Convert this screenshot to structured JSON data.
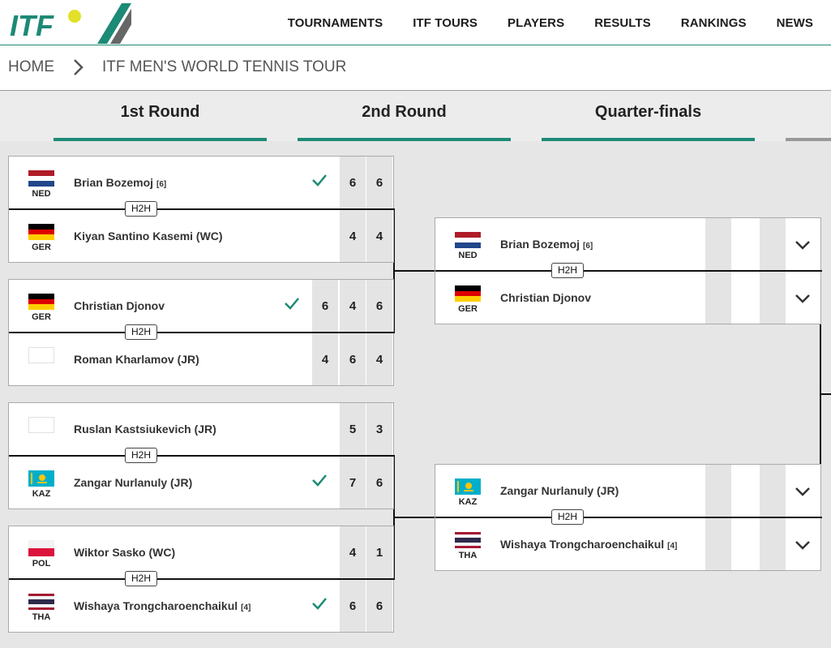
{
  "header": {
    "logo_text": "ITF",
    "nav": [
      "TOURNAMENTS",
      "ITF TOURS",
      "PLAYERS",
      "RESULTS",
      "RANKINGS",
      "NEWS"
    ],
    "brand_color": "#1d8a76"
  },
  "breadcrumb": {
    "home": "HOME",
    "separator": ">",
    "current": "ITF MEN'S WORLD TENNIS TOUR"
  },
  "rounds": [
    "1st Round",
    "2nd Round",
    "Quarter-finals"
  ],
  "h2h_label": "H2H",
  "first_round": [
    {
      "players": [
        {
          "name": "Brian Bozemoj",
          "seed": "[6]",
          "country": "NED",
          "flag": "ned",
          "winner": true,
          "scores": [
            "6",
            "6"
          ]
        },
        {
          "name": "Kiyan Santino Kasemi (WC)",
          "seed": "",
          "country": "GER",
          "flag": "ger",
          "winner": false,
          "scores": [
            "4",
            "4"
          ]
        }
      ]
    },
    {
      "players": [
        {
          "name": "Christian Djonov",
          "seed": "",
          "country": "GER",
          "flag": "ger",
          "winner": true,
          "scores": [
            "6",
            "4",
            "6"
          ]
        },
        {
          "name": "Roman Kharlamov (JR)",
          "seed": "",
          "country": "",
          "flag": "blank",
          "winner": false,
          "scores": [
            "4",
            "6",
            "4"
          ]
        }
      ]
    },
    {
      "players": [
        {
          "name": "Ruslan Kastsiukevich (JR)",
          "seed": "",
          "country": "",
          "flag": "blank",
          "winner": false,
          "scores": [
            "5",
            "3"
          ]
        },
        {
          "name": "Zangar Nurlanuly (JR)",
          "seed": "",
          "country": "KAZ",
          "flag": "kaz",
          "winner": true,
          "scores": [
            "7",
            "6"
          ]
        }
      ]
    },
    {
      "players": [
        {
          "name": "Wiktor Sasko (WC)",
          "seed": "",
          "country": "POL",
          "flag": "pol",
          "winner": false,
          "scores": [
            "4",
            "1"
          ]
        },
        {
          "name": "Wishaya Trongcharoenchaikul",
          "seed": "[4]",
          "country": "THA",
          "flag": "tha",
          "winner": true,
          "scores": [
            "6",
            "6"
          ]
        }
      ]
    }
  ],
  "second_round": [
    {
      "players": [
        {
          "name": "Brian Bozemoj",
          "seed": "[6]",
          "country": "NED",
          "flag": "ned"
        },
        {
          "name": "Christian Djonov",
          "seed": "",
          "country": "GER",
          "flag": "ger"
        }
      ]
    },
    {
      "players": [
        {
          "name": "Zangar Nurlanuly (JR)",
          "seed": "",
          "country": "KAZ",
          "flag": "kaz"
        },
        {
          "name": "Wishaya Trongcharoenchaikul",
          "seed": "[4]",
          "country": "THA",
          "flag": "tha"
        }
      ]
    }
  ]
}
